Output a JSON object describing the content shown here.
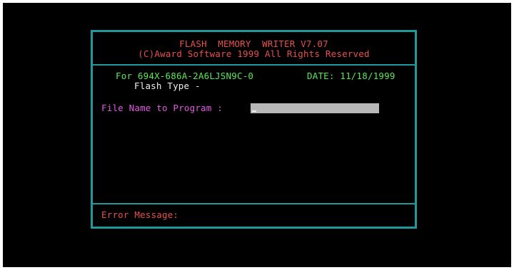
{
  "header": {
    "title": "FLASH  MEMORY  WRITER V7.07",
    "copyright": "(C)Award Software 1999 All Rights Reserved"
  },
  "info": {
    "board_id": "For 694X-686A-2A6LJSN9C-0",
    "date": "DATE: 11/18/1999",
    "flash_type": "Flash Type -"
  },
  "prompt": {
    "label": "File Name to Program :",
    "value": ""
  },
  "error": {
    "label": "Error Message:"
  },
  "colors": {
    "border": "#1f9a9a",
    "header_text": "#e84f4f",
    "info_text": "#5ae65a",
    "prompt_text": "#e05ae0",
    "input_bg": "#b8b8b8"
  }
}
